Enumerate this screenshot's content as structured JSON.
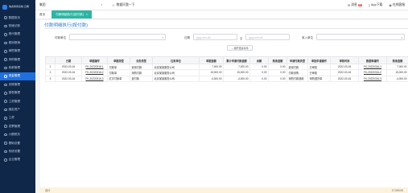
{
  "app": {
    "logo_text": "信友财务系统\n云端"
  },
  "sidebar": {
    "items": [
      {
        "label": "数据首页",
        "active": false
      },
      {
        "label": "快速记账",
        "active": false
      },
      {
        "label": "现代管理",
        "active": false
      },
      {
        "label": "费用报销",
        "active": false
      },
      {
        "label": "销售管理",
        "active": false
      },
      {
        "label": "采购管理",
        "active": false
      },
      {
        "label": "收款管理",
        "active": false
      },
      {
        "label": "资金管理",
        "active": true
      },
      {
        "label": "总账管理",
        "active": false
      },
      {
        "label": "报表管理",
        "active": false
      },
      {
        "label": "工资管理",
        "active": false
      },
      {
        "label": "固定资产",
        "active": false
      },
      {
        "label": "工资",
        "active": false
      },
      {
        "label": "发票管理",
        "active": false
      },
      {
        "label": "小额税务",
        "active": false
      },
      {
        "label": "基础设置",
        "active": false
      },
      {
        "label": "系统设置",
        "active": false
      },
      {
        "label": "企业管理",
        "active": false
      }
    ]
  },
  "topbar": {
    "company": "集团",
    "chat_label": "数据问我一下",
    "msg_label": "消息",
    "msg_badge": "99",
    "app_download": "App下载",
    "user_label": "在线客服"
  },
  "tabs": {
    "home": "首页",
    "active": "付款明细执行(按付款)"
  },
  "page": {
    "title": "付款明细执行(按付款)",
    "filters": {
      "org_label": "付款单位",
      "date_label": "日期",
      "date_start_placeholder": "yyyy-mm-dd",
      "date_end_placeholder": "yyyy-mm-dd",
      "date_sep": "至",
      "payee_label": "收入单位",
      "expand_label": "展开更多条件"
    },
    "columns": [
      "",
      "日期",
      "单据编号",
      "单据类型",
      "业务类型",
      "往来单位",
      "单据金额",
      "累计申请付款金额",
      "余额",
      "核准金额",
      "申请付款类型",
      "审批申请操作",
      "审核时间",
      "数据单编号",
      "核准金额"
    ],
    "rows": [
      {
        "no": "1",
        "date": "2022-03-16",
        "code": "FK-20220316-1",
        "doc_type": "付款单",
        "biz_type": "费用付款",
        "partner": "北京某某服务公司",
        "amount": "7,000.00",
        "applied": "7,000.00",
        "balance": "0.00",
        "approved": "0.00",
        "pay_type": "费用付款",
        "audit_op": "已审核",
        "audit_time": "2022-03-16",
        "ref_code": "FK-20220316-1",
        "final": "7,000.00",
        "neg": false
      },
      {
        "no": "2",
        "date": "2022-03-16",
        "code": "FK-20220316-2",
        "doc_type": "付款单",
        "biz_type": "采购付款",
        "partner": "北京某某服务公司",
        "amount": "15,000.00",
        "applied": "15,000.00",
        "balance": "0.00",
        "approved": "0.00",
        "pay_type": "付款采购",
        "audit_op": "已审核",
        "audit_time": "2022-03-16",
        "ref_code": "FK-20220316-2",
        "final": "15,000.00",
        "neg": false
      },
      {
        "no": "3",
        "date": "2022-03-16",
        "code": "FK-20220316-3",
        "doc_type": "红字付款单",
        "biz_type": "退付款",
        "partner": "北京某某服务公司",
        "amount": "-4,000.00",
        "applied": "-4,000.00",
        "balance": "0.00",
        "approved": "0.00",
        "pay_type": "采购付款退款",
        "audit_op": "采购退货单",
        "audit_time": "2022-03-16",
        "ref_code": "FK-20220316-3",
        "final": "-4,000.00",
        "neg": true
      }
    ],
    "footer_label": "合计",
    "footer_total": "17,000.00"
  }
}
